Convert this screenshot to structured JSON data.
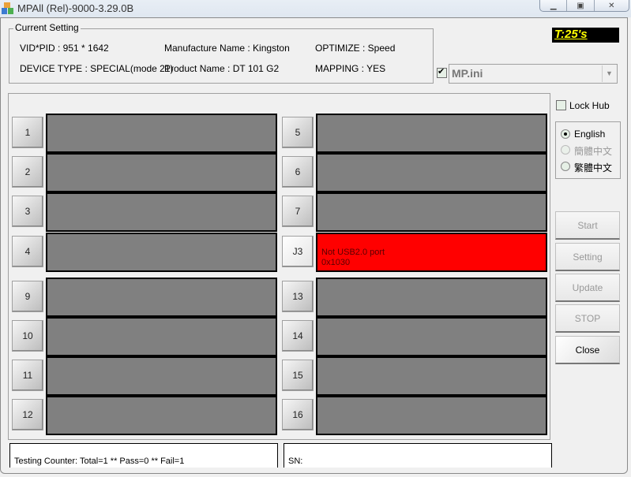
{
  "window": {
    "title": "MPAll (Rel)-9000-3.29.0B",
    "controls": [
      "minimize",
      "maximize",
      "close"
    ]
  },
  "current_setting": {
    "legend": "Current Setting",
    "vid_pid": "VID*PID :  951 * 1642",
    "device_type": "DEVICE TYPE : SPECIAL(mode 21)",
    "manufacture": "Manufacture Name : Kingston",
    "product": "Product Name : DT 101 G2",
    "optimize": "OPTIMIZE : Speed",
    "mapping": "MAPPING : YES"
  },
  "timer": "T:25's",
  "ini": {
    "checked": true,
    "value": "MP.ini"
  },
  "lock_hub": {
    "label": "Lock Hub",
    "checked": false
  },
  "languages": [
    {
      "label": "English",
      "selected": true,
      "enabled": true
    },
    {
      "label": "簡體中文",
      "selected": false,
      "enabled": false
    },
    {
      "label": "繁體中文",
      "selected": false,
      "enabled": true
    }
  ],
  "actions": [
    {
      "label": "Start",
      "enabled": false
    },
    {
      "label": "Setting",
      "enabled": false
    },
    {
      "label": "Update",
      "enabled": false
    },
    {
      "label": "STOP",
      "enabled": false
    },
    {
      "label": "Close",
      "enabled": true
    }
  ],
  "ports": [
    {
      "label": "1",
      "status": ""
    },
    {
      "label": "2",
      "status": ""
    },
    {
      "label": "3",
      "status": ""
    },
    {
      "label": "4",
      "status": ""
    },
    {
      "label": "5",
      "status": ""
    },
    {
      "label": "6",
      "status": ""
    },
    {
      "label": "7",
      "status": ""
    },
    {
      "label": "J3",
      "status": "Not USB2.0 port\n0x1030",
      "error": true,
      "error_color": "#ff0000"
    },
    {
      "label": "9",
      "status": ""
    },
    {
      "label": "10",
      "status": ""
    },
    {
      "label": "11",
      "status": ""
    },
    {
      "label": "12",
      "status": ""
    },
    {
      "label": "13",
      "status": ""
    },
    {
      "label": "14",
      "status": ""
    },
    {
      "label": "15",
      "status": ""
    },
    {
      "label": "16",
      "status": ""
    }
  ],
  "counter": "Testing Counter: Total=1 ** Pass=0 ** Fail=1",
  "sn": "SN:"
}
